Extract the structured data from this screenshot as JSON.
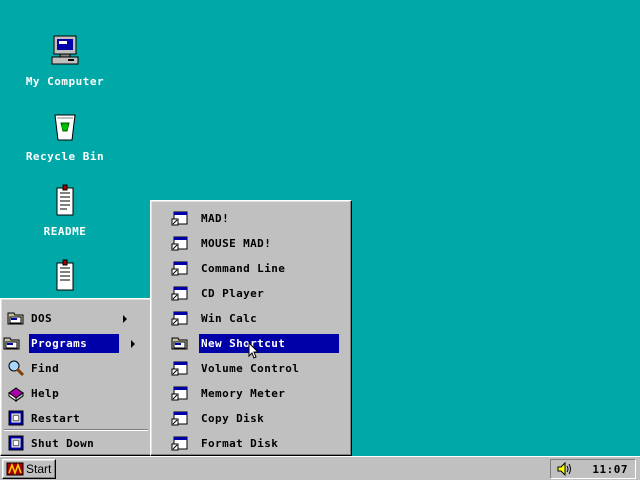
{
  "desktop": {
    "icons": [
      {
        "label": "My Computer",
        "icon": "computer-icon"
      },
      {
        "label": "Recycle Bin",
        "icon": "recycle-bin-icon"
      },
      {
        "label": "README",
        "icon": "text-document-icon"
      },
      {
        "label": "",
        "icon": "text-document-icon"
      }
    ],
    "background_color": "#00a8a8"
  },
  "start_menu": {
    "items": [
      {
        "label": "DOS",
        "icon": "folder-icon",
        "has_submenu": true
      },
      {
        "label": "Programs",
        "icon": "folder-icon",
        "has_submenu": true,
        "selected": true
      },
      {
        "label": "Find",
        "icon": "magnifier-icon"
      },
      {
        "label": "Help",
        "icon": "help-book-icon"
      },
      {
        "label": "Restart",
        "icon": "restart-icon"
      },
      {
        "label": "Shut Down",
        "icon": "shutdown-icon"
      }
    ]
  },
  "programs_menu": {
    "items": [
      {
        "label": "MAD!",
        "icon": "program-icon"
      },
      {
        "label": "MOUSE MAD!",
        "icon": "program-icon"
      },
      {
        "label": "Command Line",
        "icon": "program-icon"
      },
      {
        "label": "CD Player",
        "icon": "program-icon"
      },
      {
        "label": "Win Calc",
        "icon": "program-icon"
      },
      {
        "label": "New Shortcut",
        "icon": "folder-icon",
        "selected": true
      },
      {
        "label": "Volume Control",
        "icon": "program-icon"
      },
      {
        "label": "Memory Meter",
        "icon": "program-icon"
      },
      {
        "label": "Copy Disk",
        "icon": "program-icon"
      },
      {
        "label": "Format Disk",
        "icon": "program-icon"
      }
    ]
  },
  "taskbar": {
    "start_label": "Start",
    "clock": "11:07",
    "tray_icon": "speaker-icon"
  },
  "colors": {
    "desktop": "#00a8a8",
    "face": "#c0c0c0",
    "highlight": "#0000a8"
  }
}
